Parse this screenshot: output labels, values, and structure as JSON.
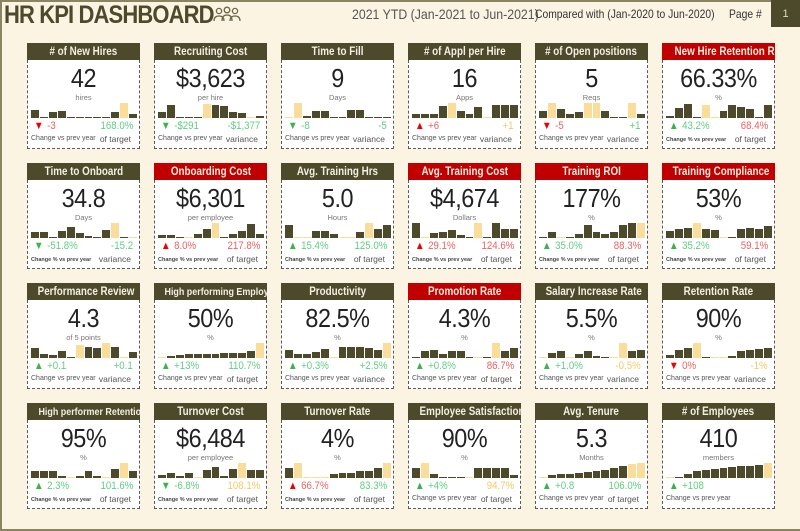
{
  "header": {
    "title": "HR KPI DASHBOARD",
    "icon": "people-group-icon",
    "period": "2021 YTD (Jan-2021 to Jun-2021)",
    "compare": "Compared with  (Jan-2020 to Jun-2020)",
    "page_label": "Page #",
    "page_number": "1"
  },
  "colors": {
    "header_bg": "#4d4a2c",
    "alert_header_bg": "#c00000",
    "bar_normal": "#4d4a2c",
    "bar_highlight": "#fadd9a",
    "good": "#5fcf84",
    "bad": "#f06060",
    "neutral": "#f5c96a",
    "background": "#fcf4e3"
  },
  "cards": [
    {
      "title": "# of New Hires",
      "alert": false,
      "value": "42",
      "unit": "hires",
      "change": "-3",
      "change_dir": "down",
      "change_color": "lred",
      "tri_color": "red",
      "variance": "168.0%",
      "variance_color": "lgreen",
      "change_label": "Change vs prev year",
      "change_label_pct": false,
      "variance_label": "of target",
      "spark": [
        0.55,
        0.1,
        0.4,
        0.5,
        0.1,
        0.1,
        0.05,
        0.1,
        0.1,
        0.4,
        1.0,
        0.3
      ],
      "spark_hi": [
        10
      ]
    },
    {
      "title": "Recruiting Cost",
      "alert": false,
      "value": "$3,623",
      "unit": "per hire",
      "change": "-$291",
      "change_dir": "down",
      "change_color": "lgreen",
      "tri_color": "green",
      "variance": "-$1,377",
      "variance_color": "lgreen",
      "change_label": "Change vs prev year",
      "change_label_pct": false,
      "variance_label": "variance",
      "spark": [
        0.4,
        0.85,
        0.1,
        0.1,
        0.1,
        0.95,
        0.85,
        0.8,
        0.4,
        0.35,
        0.05,
        0.15
      ],
      "spark_hi": [
        5,
        10
      ]
    },
    {
      "title": "Time to Fill",
      "alert": false,
      "value": "9",
      "unit": "Days",
      "change": "-8",
      "change_dir": "down",
      "change_color": "lgreen",
      "tri_color": "green",
      "variance": "-5",
      "variance_color": "lgreen",
      "change_label": "Change vs prev year",
      "change_label_pct": false,
      "variance_label": "variance",
      "spark": [
        0.05,
        1.0,
        0.15,
        0.5,
        0.45,
        0.1,
        0.1,
        0.55,
        0.55,
        0.1,
        0.1,
        0.1
      ],
      "spark_hi": [
        0,
        1
      ]
    },
    {
      "title": "# of Appl per Hire",
      "alert": false,
      "value": "16",
      "unit": "Apps",
      "change": "+6",
      "change_dir": "up",
      "change_color": "lred",
      "tri_color": "red",
      "variance": "+1",
      "variance_color": "amber",
      "change_label": "Change vs prev year",
      "change_label_pct": false,
      "variance_label": "variance",
      "spark": [
        0.3,
        0.3,
        0.3,
        0.8,
        1.0,
        0.45,
        0.3,
        0.75,
        0.1,
        0.85,
        0.85,
        0.85
      ],
      "spark_hi": [
        4,
        8
      ]
    },
    {
      "title": "# of Open positions",
      "alert": false,
      "value": "5",
      "unit": "Reqs",
      "change": "-5",
      "change_dir": "down",
      "change_color": "lred",
      "tri_color": "red",
      "variance": "+1",
      "variance_color": "lgreen",
      "change_label": "Change vs prev year",
      "change_label_pct": false,
      "variance_label": "variance",
      "spark": [
        0.45,
        1.0,
        0.6,
        0.3,
        0.4,
        1.0,
        1.0,
        0.5,
        0.1,
        0.1,
        1.0,
        0.3
      ],
      "spark_hi": [
        1,
        5,
        6,
        10
      ]
    },
    {
      "title": "New Hire Retention Rate",
      "alert": true,
      "value": "66.33%",
      "unit": "%",
      "change": "43.2%",
      "change_dir": "up",
      "change_color": "lgreen",
      "tri_color": "green",
      "variance": "68.4%",
      "variance_color": "lred",
      "change_label": "Change % vs prev year",
      "change_label_pct": true,
      "variance_label": "of target",
      "spark": [
        0.15,
        0.65,
        0.95,
        0.1,
        0.9,
        0.05,
        0.5,
        0.85,
        0.75,
        0.6,
        0.1,
        0.9
      ],
      "spark_hi": [
        4,
        5
      ]
    },
    {
      "title": "Time to Onboard",
      "alert": false,
      "value": "34.8",
      "unit": "Days",
      "change": "-51.8%",
      "change_dir": "down",
      "change_color": "lgreen",
      "tri_color": "green",
      "variance": "-15.2",
      "variance_color": "lgreen",
      "change_label": "Change % vs prev year",
      "change_label_pct": true,
      "variance_label": "variance",
      "spark": [
        0.4,
        0.4,
        0.1,
        0.45,
        0.75,
        0.35,
        0.15,
        0.1,
        0.55,
        1.0,
        0.1,
        0.05
      ],
      "spark_hi": [
        9,
        11
      ]
    },
    {
      "title": "Onboarding Cost",
      "alert": true,
      "value": "$6,301",
      "unit": "per employee",
      "change": "8.0%",
      "change_dir": "up",
      "change_color": "lred",
      "tri_color": "red",
      "variance": "217.8%",
      "variance_color": "lred",
      "change_label": "Change % vs prev year",
      "change_label_pct": true,
      "variance_label": "of target",
      "spark": [
        0.2,
        0.2,
        0.1,
        0.05,
        0.25,
        0.6,
        1.0,
        0.1,
        0.3,
        0.5,
        0.95,
        0.3
      ],
      "spark_hi": [
        3,
        6
      ]
    },
    {
      "title": "Avg. Training Hrs",
      "alert": false,
      "value": "5.0",
      "unit": "Hours",
      "change": "15.4%",
      "change_dir": "up",
      "change_color": "lgreen",
      "tri_color": "green",
      "variance": "125.0%",
      "variance_color": "lgreen",
      "change_label": "Change % vs prev year",
      "change_label_pct": true,
      "variance_label": "of target",
      "spark": [
        0.85,
        0.05,
        0.05,
        0.45,
        0.45,
        0.3,
        0.05,
        0.05,
        0.4,
        1.0,
        0.6,
        0.9
      ],
      "spark_hi": [
        1,
        2,
        6,
        7,
        9
      ]
    },
    {
      "title": "Avg. Training Cost",
      "alert": true,
      "value": "$4,674",
      "unit": "Dollars",
      "change": "29.1%",
      "change_dir": "up",
      "change_color": "lred",
      "tri_color": "red",
      "variance": "124.6%",
      "variance_color": "lred",
      "change_label": "Change % vs prev year",
      "change_label_pct": true,
      "variance_label": "of target",
      "spark": [
        1.0,
        0.05,
        0.35,
        0.4,
        0.55,
        0.2,
        0.1,
        1.0,
        0.1,
        1.0,
        0.6,
        0.6
      ],
      "spark_hi": [
        1,
        7
      ]
    },
    {
      "title": "Training ROI",
      "alert": true,
      "value": "177%",
      "unit": "%",
      "change": "35.0%",
      "change_dir": "up",
      "change_color": "lgreen",
      "tri_color": "green",
      "variance": "88.3%",
      "variance_color": "lred",
      "change_label": "Change % vs prev year",
      "change_label_pct": true,
      "variance_label": "of target",
      "spark": [
        0.1,
        0.4,
        0.05,
        0.1,
        0.25,
        0.85,
        0.4,
        0.3,
        0.4,
        0.85,
        1.0,
        1.0
      ],
      "spark_hi": [
        2,
        11
      ]
    },
    {
      "title": "Training Compliance",
      "alert": true,
      "value": "53%",
      "unit": "%",
      "change": "35.2%",
      "change_dir": "up",
      "change_color": "lgreen",
      "tri_color": "green",
      "variance": "59.1%",
      "variance_color": "lred",
      "change_label": "Change % vs prev year",
      "change_label_pct": true,
      "variance_label": "of target",
      "spark": [
        0.45,
        0.6,
        0.65,
        1.0,
        0.6,
        0.55,
        0.05,
        0.1,
        0.6,
        0.65,
        0.6,
        0.8
      ],
      "spark_hi": [
        3,
        6
      ]
    },
    {
      "title": "Performance Review",
      "alert": false,
      "value": "4.3",
      "unit": "of 5 points",
      "change": "+0.1",
      "change_dir": "up",
      "change_color": "lgreen",
      "tri_color": "green",
      "variance": "+0.1",
      "variance_color": "lgreen",
      "change_label": "Change vs prev year",
      "change_label_pct": false,
      "variance_label": "variance",
      "spark": [
        0.7,
        0.3,
        0.2,
        0.45,
        0.1,
        0.9,
        0.75,
        0.65,
        1.0,
        0.75,
        0.05,
        0.4
      ],
      "spark_hi": [
        5,
        8,
        10
      ]
    },
    {
      "title": "High performing Employees",
      "alert": false,
      "small_title": true,
      "value": "50%",
      "unit": "%",
      "change": "+13%",
      "change_dir": "up",
      "change_color": "lgreen",
      "tri_color": "green",
      "variance": "110.7%",
      "variance_color": "lgreen",
      "change_label": "Change vs prev year",
      "change_label_pct": false,
      "variance_label": "of target",
      "spark": [
        0.05,
        0.15,
        0.2,
        0.25,
        0.25,
        0.25,
        0.3,
        0.35,
        0.35,
        0.35,
        0.45,
        1.0
      ],
      "spark_hi": [
        0,
        11
      ]
    },
    {
      "title": "Productivity",
      "alert": false,
      "value": "82.5%",
      "unit": "%",
      "change": "+0.3%",
      "change_dir": "up",
      "change_color": "lgreen",
      "tri_color": "green",
      "variance": "+2.5%",
      "variance_color": "lgreen",
      "change_label": "Change vs prev year",
      "change_label_pct": false,
      "variance_label": "variance",
      "spark": [
        0.55,
        0.3,
        0.3,
        0.4,
        0.6,
        0.1,
        0.75,
        0.75,
        0.75,
        0.65,
        0.55,
        1.0
      ],
      "spark_hi": [
        5,
        11
      ]
    },
    {
      "title": "Promotion Rate",
      "alert": true,
      "value": "4.3%",
      "unit": "%",
      "change": "+0.8%",
      "change_dir": "up",
      "change_color": "lgreen",
      "tri_color": "green",
      "variance": "86.7%",
      "variance_color": "lred",
      "change_label": "Change vs prev year",
      "change_label_pct": false,
      "variance_label": "of target",
      "spark": [
        0.1,
        0.45,
        0.55,
        0.3,
        0.45,
        0.45,
        0.1,
        0.05,
        0.1,
        1.0,
        0.5,
        0.7
      ],
      "spark_hi": [
        7,
        9
      ]
    },
    {
      "title": "Salary Increase Rate",
      "alert": false,
      "value": "5.5%",
      "unit": "%",
      "change": "+1.0%",
      "change_dir": "up",
      "change_color": "lgreen",
      "tri_color": "green",
      "variance": "-0.5%",
      "variance_color": "amber",
      "change_label": "Change vs prev year",
      "change_label_pct": false,
      "variance_label": "variance",
      "spark": [
        0.05,
        0.35,
        0.45,
        0.05,
        0.3,
        0.5,
        0.15,
        0.05,
        0.05,
        1.0,
        0.45,
        0.55
      ],
      "spark_hi": [
        0,
        3,
        8,
        9
      ]
    },
    {
      "title": "Retention Rate",
      "alert": false,
      "value": "90%",
      "unit": "%",
      "change": "0%",
      "change_dir": "down",
      "change_color": "lred",
      "tri_color": "red",
      "variance": "-1%",
      "variance_color": "amber",
      "change_label": "Change vs prev year",
      "change_label_pct": false,
      "variance_label": "variance",
      "spark": [
        0.2,
        0.55,
        0.65,
        1.0,
        0.1,
        0.05,
        0.05,
        0.15,
        0.45,
        0.55,
        0.6,
        0.7
      ],
      "spark_hi": [
        3,
        5,
        6
      ]
    },
    {
      "title": "High performer Retention Rate",
      "alert": false,
      "small_title": true,
      "value": "95%",
      "unit": "%",
      "change": "2.3%",
      "change_dir": "up",
      "change_color": "lgreen",
      "tri_color": "green",
      "variance": "101.6%",
      "variance_color": "lgreen",
      "change_label": "Change % vs prev year",
      "change_label_pct": true,
      "variance_label": "of target",
      "spark": [
        0.5,
        0.5,
        0.5,
        0.15,
        0.05,
        0.15,
        0.5,
        0.15,
        0.05,
        0.6,
        1.0,
        0.45
      ],
      "spark_hi": [
        4,
        8,
        10
      ]
    },
    {
      "title": "Turnover Cost",
      "alert": false,
      "value": "$6,484",
      "unit": "per employee",
      "change": "-6.8%",
      "change_dir": "down",
      "change_color": "lgreen",
      "tri_color": "green",
      "variance": "108.1%",
      "variance_color": "amber",
      "change_label": "Change % vs prev year",
      "change_label_pct": true,
      "variance_label": "of target",
      "spark": [
        0.2,
        0.35,
        0.15,
        0.35,
        0.05,
        0.55,
        0.75,
        0.15,
        0.6,
        1.0,
        0.55,
        0.55
      ],
      "spark_hi": [
        4,
        9
      ]
    },
    {
      "title": "Turnover Rate",
      "alert": false,
      "value": "4%",
      "unit": "%",
      "change": "66.7%",
      "change_dir": "up",
      "change_color": "lred",
      "tri_color": "red",
      "variance": "83.3%",
      "variance_color": "lgreen",
      "change_label": "Change % vs prev year",
      "change_label_pct": true,
      "variance_label": "of target",
      "spark": [
        0.7,
        1.0,
        0.05,
        0.05,
        0.05,
        0.3,
        0.35,
        0.35,
        0.45,
        0.5,
        0.7,
        1.0
      ],
      "spark_hi": [
        1,
        2,
        3,
        4,
        11
      ]
    },
    {
      "title": "Employee Satisfaction",
      "alert": false,
      "value": "90%",
      "unit": "%",
      "change": "+4%",
      "change_dir": "up",
      "change_color": "lgreen",
      "tri_color": "green",
      "variance": "94.7%",
      "variance_color": "amber",
      "change_label": "Change vs prev year",
      "change_label_pct": false,
      "variance_label": "of target",
      "spark": [
        0.65,
        1.0,
        0.25,
        0.1,
        0.1,
        0.1,
        0.05,
        0.7,
        0.7,
        0.7,
        0.7,
        0.2
      ],
      "spark_hi": [
        1,
        6
      ]
    },
    {
      "title": "Avg. Tenure",
      "alert": false,
      "value": "5.3",
      "unit": "Months",
      "change": "+0.8",
      "change_dir": "up",
      "change_color": "lgreen",
      "tri_color": "green",
      "variance": "106.0%",
      "variance_color": "lgreen",
      "change_label": "Change vs prev year",
      "change_label_pct": false,
      "variance_label": "of target",
      "spark": [
        0.05,
        0.2,
        0.25,
        0.3,
        0.35,
        0.4,
        0.5,
        0.55,
        0.65,
        0.8,
        0.95,
        1.0
      ],
      "spark_hi": [
        0,
        10,
        11
      ]
    },
    {
      "title": "# of Employees",
      "alert": false,
      "value": "410",
      "unit": "members",
      "change": "+108",
      "change_dir": "up",
      "change_color": "lgreen",
      "tri_color": "green",
      "variance": "",
      "variance_color": "lgreen",
      "change_label": "Change vs prev year",
      "change_label_pct": false,
      "variance_label": "",
      "spark": [
        0.05,
        0.1,
        0.3,
        0.5,
        0.55,
        0.6,
        0.65,
        0.75,
        0.8,
        0.8,
        0.85,
        1.0
      ],
      "spark_hi": [
        0,
        11
      ]
    }
  ]
}
